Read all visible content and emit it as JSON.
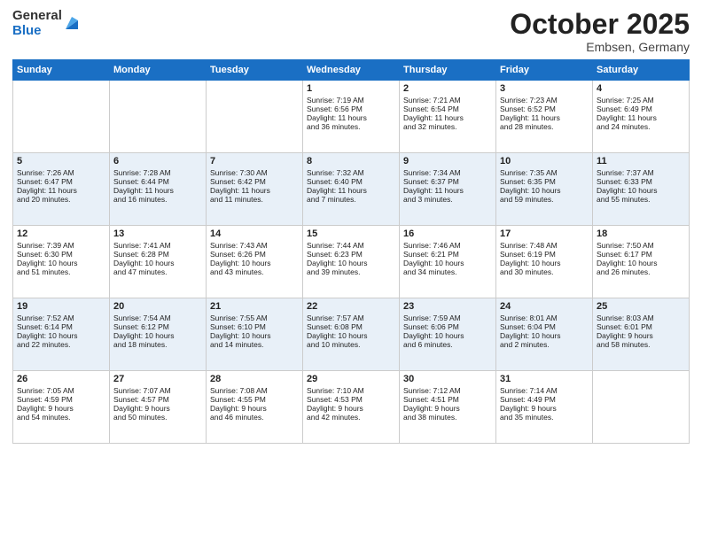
{
  "logo": {
    "general": "General",
    "blue": "Blue"
  },
  "title": "October 2025",
  "location": "Embsen, Germany",
  "days_header": [
    "Sunday",
    "Monday",
    "Tuesday",
    "Wednesday",
    "Thursday",
    "Friday",
    "Saturday"
  ],
  "weeks": [
    {
      "cells": [
        {
          "day": "",
          "info": ""
        },
        {
          "day": "",
          "info": ""
        },
        {
          "day": "",
          "info": ""
        },
        {
          "day": "1",
          "info": "Sunrise: 7:19 AM\nSunset: 6:56 PM\nDaylight: 11 hours\nand 36 minutes."
        },
        {
          "day": "2",
          "info": "Sunrise: 7:21 AM\nSunset: 6:54 PM\nDaylight: 11 hours\nand 32 minutes."
        },
        {
          "day": "3",
          "info": "Sunrise: 7:23 AM\nSunset: 6:52 PM\nDaylight: 11 hours\nand 28 minutes."
        },
        {
          "day": "4",
          "info": "Sunrise: 7:25 AM\nSunset: 6:49 PM\nDaylight: 11 hours\nand 24 minutes."
        }
      ]
    },
    {
      "cells": [
        {
          "day": "5",
          "info": "Sunrise: 7:26 AM\nSunset: 6:47 PM\nDaylight: 11 hours\nand 20 minutes."
        },
        {
          "day": "6",
          "info": "Sunrise: 7:28 AM\nSunset: 6:44 PM\nDaylight: 11 hours\nand 16 minutes."
        },
        {
          "day": "7",
          "info": "Sunrise: 7:30 AM\nSunset: 6:42 PM\nDaylight: 11 hours\nand 11 minutes."
        },
        {
          "day": "8",
          "info": "Sunrise: 7:32 AM\nSunset: 6:40 PM\nDaylight: 11 hours\nand 7 minutes."
        },
        {
          "day": "9",
          "info": "Sunrise: 7:34 AM\nSunset: 6:37 PM\nDaylight: 11 hours\nand 3 minutes."
        },
        {
          "day": "10",
          "info": "Sunrise: 7:35 AM\nSunset: 6:35 PM\nDaylight: 10 hours\nand 59 minutes."
        },
        {
          "day": "11",
          "info": "Sunrise: 7:37 AM\nSunset: 6:33 PM\nDaylight: 10 hours\nand 55 minutes."
        }
      ]
    },
    {
      "cells": [
        {
          "day": "12",
          "info": "Sunrise: 7:39 AM\nSunset: 6:30 PM\nDaylight: 10 hours\nand 51 minutes."
        },
        {
          "day": "13",
          "info": "Sunrise: 7:41 AM\nSunset: 6:28 PM\nDaylight: 10 hours\nand 47 minutes."
        },
        {
          "day": "14",
          "info": "Sunrise: 7:43 AM\nSunset: 6:26 PM\nDaylight: 10 hours\nand 43 minutes."
        },
        {
          "day": "15",
          "info": "Sunrise: 7:44 AM\nSunset: 6:23 PM\nDaylight: 10 hours\nand 39 minutes."
        },
        {
          "day": "16",
          "info": "Sunrise: 7:46 AM\nSunset: 6:21 PM\nDaylight: 10 hours\nand 34 minutes."
        },
        {
          "day": "17",
          "info": "Sunrise: 7:48 AM\nSunset: 6:19 PM\nDaylight: 10 hours\nand 30 minutes."
        },
        {
          "day": "18",
          "info": "Sunrise: 7:50 AM\nSunset: 6:17 PM\nDaylight: 10 hours\nand 26 minutes."
        }
      ]
    },
    {
      "cells": [
        {
          "day": "19",
          "info": "Sunrise: 7:52 AM\nSunset: 6:14 PM\nDaylight: 10 hours\nand 22 minutes."
        },
        {
          "day": "20",
          "info": "Sunrise: 7:54 AM\nSunset: 6:12 PM\nDaylight: 10 hours\nand 18 minutes."
        },
        {
          "day": "21",
          "info": "Sunrise: 7:55 AM\nSunset: 6:10 PM\nDaylight: 10 hours\nand 14 minutes."
        },
        {
          "day": "22",
          "info": "Sunrise: 7:57 AM\nSunset: 6:08 PM\nDaylight: 10 hours\nand 10 minutes."
        },
        {
          "day": "23",
          "info": "Sunrise: 7:59 AM\nSunset: 6:06 PM\nDaylight: 10 hours\nand 6 minutes."
        },
        {
          "day": "24",
          "info": "Sunrise: 8:01 AM\nSunset: 6:04 PM\nDaylight: 10 hours\nand 2 minutes."
        },
        {
          "day": "25",
          "info": "Sunrise: 8:03 AM\nSunset: 6:01 PM\nDaylight: 9 hours\nand 58 minutes."
        }
      ]
    },
    {
      "cells": [
        {
          "day": "26",
          "info": "Sunrise: 7:05 AM\nSunset: 4:59 PM\nDaylight: 9 hours\nand 54 minutes."
        },
        {
          "day": "27",
          "info": "Sunrise: 7:07 AM\nSunset: 4:57 PM\nDaylight: 9 hours\nand 50 minutes."
        },
        {
          "day": "28",
          "info": "Sunrise: 7:08 AM\nSunset: 4:55 PM\nDaylight: 9 hours\nand 46 minutes."
        },
        {
          "day": "29",
          "info": "Sunrise: 7:10 AM\nSunset: 4:53 PM\nDaylight: 9 hours\nand 42 minutes."
        },
        {
          "day": "30",
          "info": "Sunrise: 7:12 AM\nSunset: 4:51 PM\nDaylight: 9 hours\nand 38 minutes."
        },
        {
          "day": "31",
          "info": "Sunrise: 7:14 AM\nSunset: 4:49 PM\nDaylight: 9 hours\nand 35 minutes."
        },
        {
          "day": "",
          "info": ""
        }
      ]
    }
  ]
}
